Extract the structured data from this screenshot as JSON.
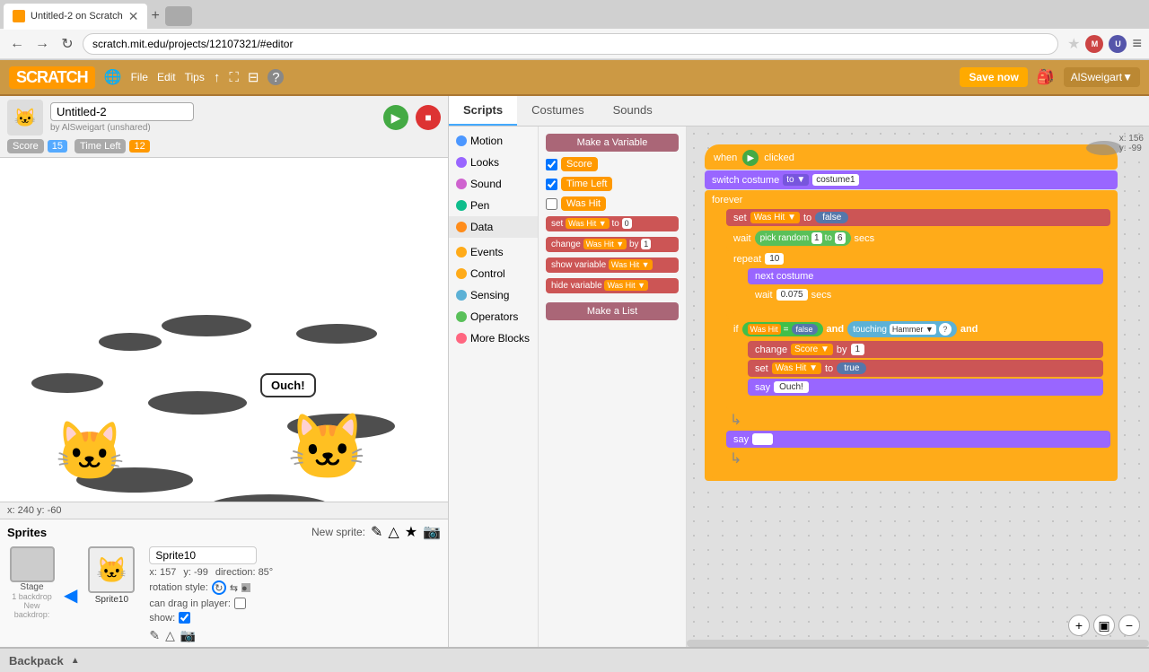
{
  "browser": {
    "tab_title": "Untitled-2 on Scratch",
    "url": "scratch.mit.edu/projects/12107321/#editor",
    "new_tab_symbol": "+"
  },
  "scratch_bar": {
    "logo": "SCRATCH",
    "file": "File",
    "edit": "Edit",
    "tips": "Tips",
    "save_now": "Save now",
    "user": "AlSweigart▼"
  },
  "stage_header": {
    "sprite_name": "Untitled-2",
    "by_line": "by AlSweigart (unshared)"
  },
  "hud": {
    "score_label": "Score",
    "score_value": "15",
    "timeleft_label": "Time Left",
    "timeleft_value": "12"
  },
  "stage_footer": {
    "coords": "x: 240  y: -60"
  },
  "tabs": {
    "scripts": "Scripts",
    "costumes": "Costumes",
    "sounds": "Sounds"
  },
  "categories": [
    {
      "id": "motion",
      "label": "Motion",
      "color": "#4c97ff"
    },
    {
      "id": "looks",
      "label": "Looks",
      "color": "#9966ff"
    },
    {
      "id": "sound",
      "label": "Sound",
      "color": "#cf63cf"
    },
    {
      "id": "pen",
      "label": "Pen",
      "color": "#0fbd8c"
    },
    {
      "id": "data",
      "label": "Data",
      "color": "#ff8c1a",
      "active": true
    },
    {
      "id": "events",
      "label": "Events",
      "color": "#ffab19"
    },
    {
      "id": "control",
      "label": "Control",
      "color": "#ffab19"
    },
    {
      "id": "sensing",
      "label": "Sensing",
      "color": "#5cb1d6"
    },
    {
      "id": "operators",
      "label": "Operators",
      "color": "#59c059"
    },
    {
      "id": "more",
      "label": "More Blocks",
      "color": "#ff6680"
    }
  ],
  "palette": {
    "make_variable": "Make a Variable",
    "variables": [
      {
        "label": "Score",
        "checked": true
      },
      {
        "label": "Time Left",
        "checked": true
      },
      {
        "label": "Was Hit",
        "checked": false
      }
    ],
    "blocks": [
      {
        "label": "set Was Hit ▼ to 0"
      },
      {
        "label": "change Was Hit ▼ by 1"
      },
      {
        "label": "show variable Was Hit ▼"
      },
      {
        "label": "hide variable Was Hit ▼"
      }
    ],
    "make_list": "Make a List"
  },
  "script": {
    "when_clicked": "when",
    "clicked": "clicked",
    "switch_costume": "switch costume",
    "to": "to",
    "costume1": "costume1",
    "forever": "forever",
    "set": "set",
    "was_hit": "Was Hit",
    "false_val": "false",
    "true_val": "true",
    "wait": "wait",
    "pick_random": "pick random",
    "r1": "1",
    "r2": "6",
    "secs": "secs",
    "repeat": "repeat",
    "repeat_n": "10",
    "next_costume": "next costume",
    "wait2": "wait",
    "wait_val": "0.075",
    "if_label": "if",
    "was_hit2": "Was Hit",
    "equals": "=",
    "and1": "and",
    "touching": "touching",
    "hammer": "Hammer",
    "and2": "and",
    "change": "change",
    "score": "Score",
    "by": "by",
    "by_val": "1",
    "set2": "set",
    "was_hit3": "Was Hit",
    "to2": "to",
    "say": "say",
    "ouch": "Ouch!",
    "say2": "say",
    "say_end": "say"
  },
  "sprites": {
    "title": "Sprites",
    "new_sprite": "New sprite:",
    "stage_label": "Stage",
    "stage_sub": "1 backdrop",
    "new_backdrop": "New backdrop:",
    "sprite_name": "Sprite10",
    "x": "x: 157",
    "y": "y: -99",
    "direction": "direction: 85°",
    "rotation": "rotation style:",
    "can_drag": "can drag in player:",
    "show": "show:"
  },
  "backpack": {
    "label": "Backpack"
  }
}
